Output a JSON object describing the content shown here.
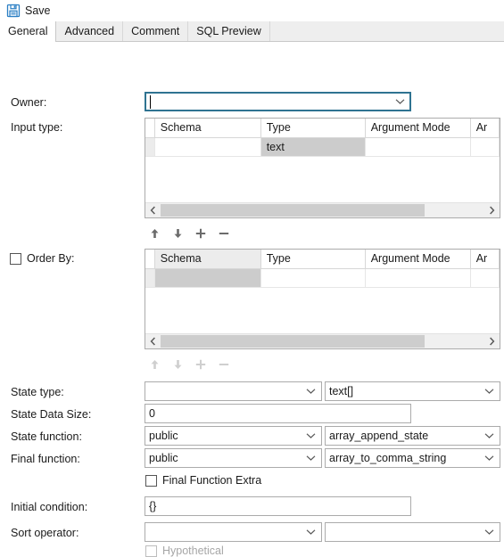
{
  "toolbar": {
    "save_label": "Save",
    "save_icon": "floppy-save-icon"
  },
  "tabs": [
    {
      "label": "General",
      "active": true
    },
    {
      "label": "Advanced",
      "active": false
    },
    {
      "label": "Comment",
      "active": false
    },
    {
      "label": "SQL Preview",
      "active": false
    }
  ],
  "form": {
    "owner": {
      "label": "Owner:",
      "value": "",
      "focused": true
    },
    "input_type": {
      "label": "Input type:",
      "columns": [
        "Schema",
        "Type",
        "Argument Mode",
        "Ar"
      ],
      "rows": [
        {
          "schema": "",
          "type": "text",
          "argument_mode": "",
          "ar": "",
          "selected_column": "Type"
        }
      ],
      "scroll_position": "left",
      "toolbar": {
        "enabled": true,
        "buttons": [
          "move-up",
          "move-down",
          "add",
          "remove"
        ],
        "glyphs": [
          "↑",
          "↓",
          "+",
          "−"
        ]
      }
    },
    "order_by": {
      "label": "Order By:",
      "checked": false,
      "columns": [
        "Schema",
        "Type",
        "Argument Mode",
        "Ar"
      ],
      "rows": [
        {
          "schema": "",
          "type": "",
          "argument_mode": "",
          "ar": "",
          "selected_column": "Schema"
        }
      ],
      "scroll_position": "left",
      "toolbar": {
        "enabled": false,
        "buttons": [
          "move-up",
          "move-down",
          "add",
          "remove"
        ],
        "glyphs": [
          "↑",
          "↓",
          "+",
          "−"
        ]
      }
    },
    "state_type": {
      "label": "State type:",
      "schema_value": "",
      "type_value": "text[]"
    },
    "state_data_size": {
      "label": "State Data Size:",
      "value": "0"
    },
    "state_function": {
      "label": "State function:",
      "schema_value": "public",
      "function_value": "array_append_state"
    },
    "final_function": {
      "label": "Final function:",
      "schema_value": "public",
      "function_value": "array_to_comma_string"
    },
    "final_function_extra": {
      "label": "Final Function Extra",
      "checked": false
    },
    "initial_condition": {
      "label": "Initial condition:",
      "value": "{}"
    },
    "sort_operator": {
      "label": "Sort operator:",
      "schema_value": "",
      "operator_value": ""
    },
    "hypothetical": {
      "label": "Hypothetical",
      "checked": false,
      "disabled": true
    }
  },
  "colors": {
    "focus_border": "#2f7391",
    "tab_strip_bg": "#eeeeee",
    "selection_gray": "#cccccc",
    "save_icon_blue": "#2b7fc4"
  }
}
